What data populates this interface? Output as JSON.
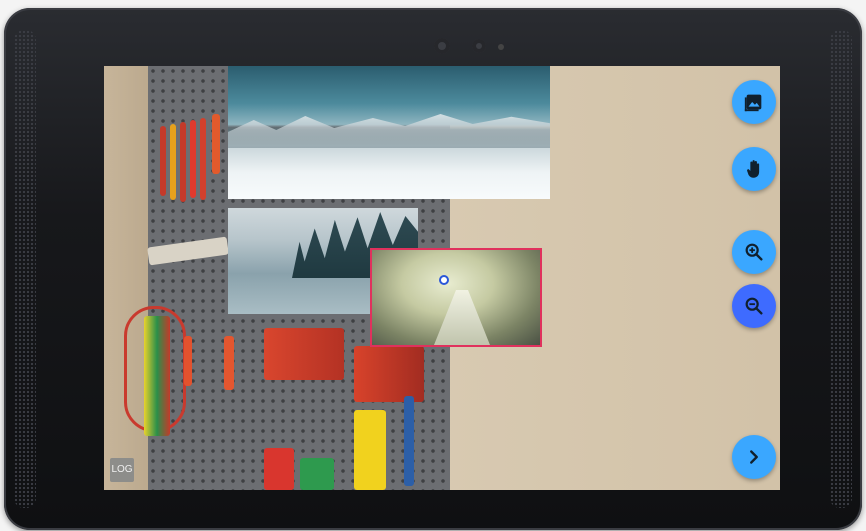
{
  "device": {
    "frame_color": "#17181b"
  },
  "screen": {
    "photos": [
      {
        "id": "snow-mountains",
        "selected": false
      },
      {
        "id": "frozen-lake",
        "selected": false
      },
      {
        "id": "snowy-forest-road",
        "selected": true,
        "border_color": "#e0315d"
      }
    ]
  },
  "toolbar": {
    "accent_color": "#3aa7ff",
    "active_color": "#3e6bff",
    "buttons": [
      {
        "name": "add-image-button",
        "icon": "image-icon"
      },
      {
        "name": "pan-button",
        "icon": "hand-icon"
      },
      {
        "name": "zoom-in-button",
        "icon": "zoom-in-icon"
      },
      {
        "name": "zoom-out-button",
        "icon": "zoom-out-icon",
        "active": true
      },
      {
        "name": "next-button",
        "icon": "chevron-right-icon"
      }
    ]
  },
  "log_button": {
    "label": "LOG"
  }
}
